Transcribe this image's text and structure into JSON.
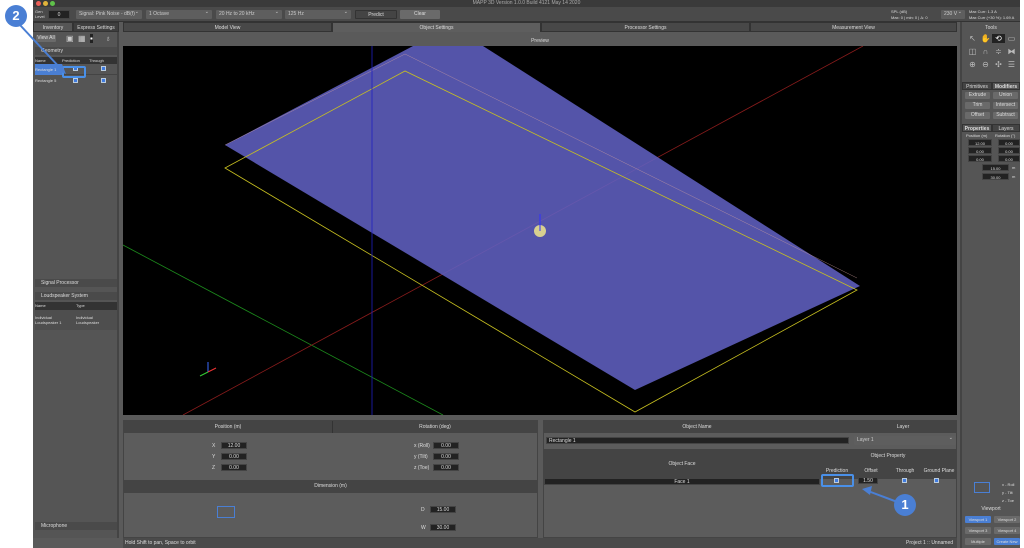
{
  "window": {
    "title": "MAPP 3D Version 1.0.0 Build 4121 May 14 2020"
  },
  "toolbar": {
    "gen_level_label": "Gen Level",
    "gen_level_value": "0",
    "signal": "Signal: Pink Noise - dB(f)",
    "octave": "1 Octave",
    "range": "20 Hz to 20 kHz",
    "freq": "125 Hz",
    "predict": "Predict",
    "clear": "Clear",
    "spl_title": "SPL (dB)",
    "spl_values": "Max: 0 | min: 0 | Δ: 0",
    "voltage": "230 V",
    "max_curr": "Max Curr: 1.3  A",
    "max_curr_30": "Max Curr (+30 %): 1.69 A"
  },
  "left": {
    "tabs": [
      "Inventory",
      "Express Settings"
    ],
    "view_all": "View All",
    "geometry": "Geometry",
    "geo_cols": [
      "Name",
      "Prediction",
      "Through"
    ],
    "geo_rows": [
      {
        "name": "Rectangle 1",
        "prediction": true,
        "through": true
      },
      {
        "name": "Rectangle 5",
        "prediction": true,
        "through": true
      }
    ],
    "signal_processor": "Signal Processor",
    "loudspeaker_system": "Loudspeaker System",
    "ls_cols": [
      "Name",
      "Type"
    ],
    "ls_rows": [
      {
        "name": "Individual Loudspeaker 1",
        "type": "Individual Loudspeaker"
      }
    ],
    "microphone": "Microphone"
  },
  "main": {
    "tabs": [
      "Model View",
      "Object Settings",
      "Processor Settings",
      "Measurement View"
    ],
    "active_tab": "Object Settings",
    "preview": "Preview"
  },
  "position": {
    "title": "Position (m)",
    "x_label": "X",
    "x": "12.00",
    "y_label": "Y",
    "y": "0.00",
    "z_label": "Z",
    "z": "0.00"
  },
  "rotation": {
    "title": "Rotation (deg)",
    "roll_label": "x (Roll)",
    "roll": "0.00",
    "tilt_label": "y (Tilt)",
    "tilt": "0.00",
    "toe_label": "z (Toe)",
    "toe": "0.00"
  },
  "dimension": {
    "title": "Dimension (m)",
    "d_label": "D",
    "d": "15.00",
    "w_label": "W",
    "w": "30.00"
  },
  "object": {
    "name_title": "Object Name",
    "name": "Rectangle 1",
    "layer_title": "Layer",
    "layer": "Layer 1",
    "face_title": "Object Face",
    "prop_title": "Object Property",
    "prop_cols": [
      "Prediction",
      "Offset",
      "Through",
      "Ground Plane"
    ],
    "face": "Face 1",
    "offset": "1.50"
  },
  "status": {
    "hint": "Hold Shift to pan, Space to orbit",
    "project": "Project 1 :: Unnamed"
  },
  "right": {
    "tools": "Tools",
    "prim_tabs": [
      "Primitives",
      "Modifiers"
    ],
    "mod_buttons": [
      "Extrude",
      "Union",
      "Trim",
      "Intersect",
      "Offset",
      "Subtract"
    ],
    "prop_tabs": [
      "Properties",
      "Layers"
    ],
    "pos_label": "Position (m)",
    "rot_label": "Rotation (°)",
    "x": "12.00",
    "y": "0.00",
    "z": "0.00",
    "rx": "0.00",
    "ry": "0.00",
    "rz": "0.00",
    "d": "15.00",
    "w": "30.00",
    "unit": "m",
    "legend": [
      "x - Roll",
      "y - Tilt",
      "z - Toe"
    ],
    "viewport": "Viewport",
    "vp_buttons": [
      "Viewport 1",
      "Viewport 2",
      "Viewport 3",
      "Viewport 4",
      "Multiple",
      "Create New"
    ]
  },
  "annotations": [
    "1",
    "2"
  ]
}
